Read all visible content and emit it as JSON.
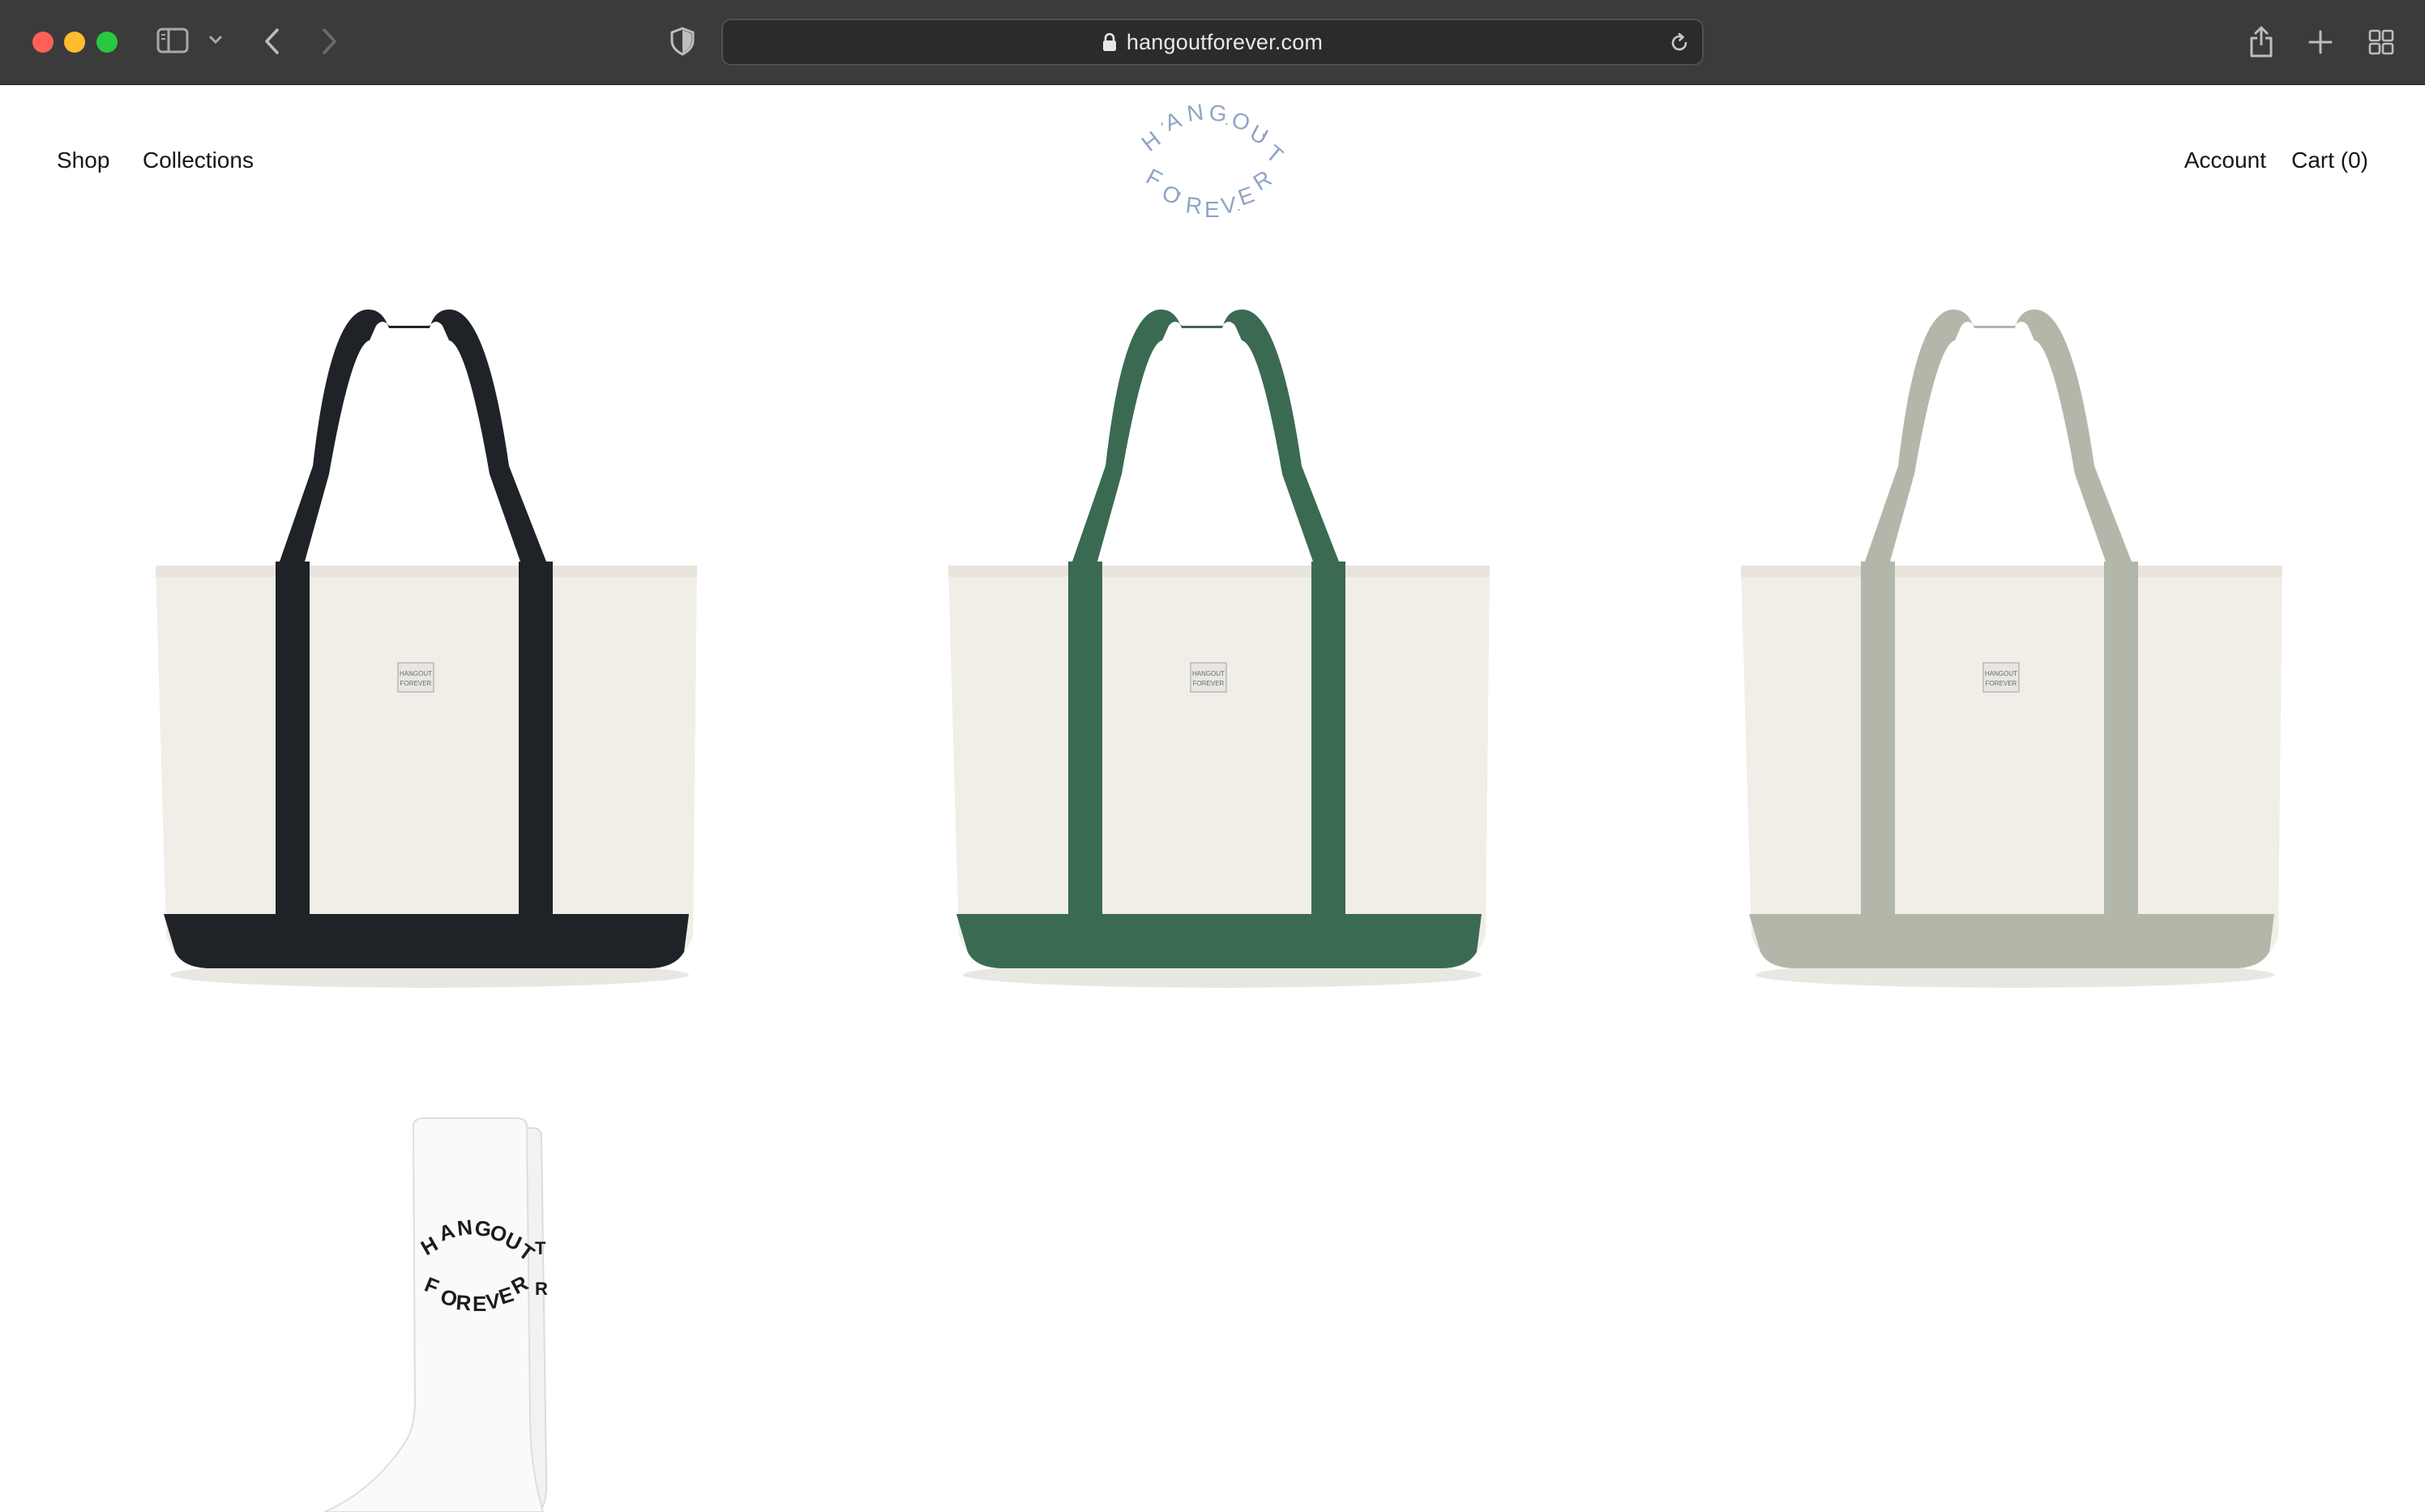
{
  "browser": {
    "url": "hangoutforever.com",
    "icons": [
      "sidebar-icon",
      "chevron-down-icon",
      "back-icon",
      "forward-icon",
      "shield-icon",
      "lock-icon",
      "reload-icon",
      "share-icon",
      "plus-icon",
      "tabs-grid-icon"
    ]
  },
  "site": {
    "logo_text": "HANGOUT FOREVER",
    "logo_color": "#8ea4c4",
    "nav_left": {
      "shop": "Shop",
      "collections": "Collections"
    },
    "nav_right": {
      "account": "Account",
      "cart": "Cart (0)"
    }
  },
  "products": [
    {
      "kind": "tote",
      "accent_color": "#1f2227"
    },
    {
      "kind": "tote",
      "accent_color": "#3b6a52"
    },
    {
      "kind": "tote",
      "accent_color": "#b3b7aa"
    },
    {
      "kind": "sock",
      "accent_color": "#1c1c1c"
    }
  ],
  "colors": {
    "chrome_bg": "#3b3b3b",
    "canvas": "#f3f1ec",
    "page_bg": "#ffffff"
  }
}
